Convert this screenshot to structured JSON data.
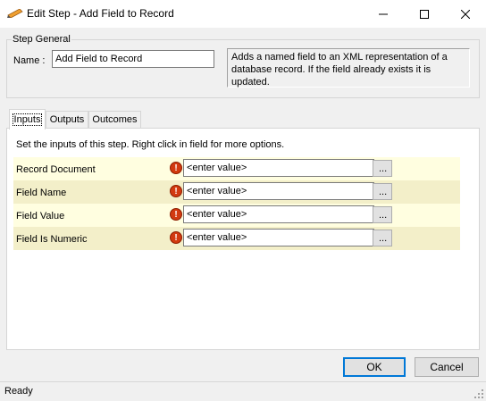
{
  "window": {
    "title": "Edit Step - Add Field to Record",
    "controls": {
      "minimize": "minimize-icon",
      "maximize": "maximize-icon",
      "close": "close-icon"
    }
  },
  "step_general": {
    "group_label": "Step General",
    "name_label": "Name :",
    "name_value": "Add Field to Record",
    "description": "Adds a named field to an XML representation of a database record. If the field already exists it is updated."
  },
  "tabs": [
    {
      "label": "Inputs",
      "active": true
    },
    {
      "label": "Outputs",
      "active": false
    },
    {
      "label": "Outcomes",
      "active": false
    }
  ],
  "inputs": {
    "instructions": "Set the inputs of this step.  Right click in field for more options.",
    "placeholder": "<enter value>",
    "browse_label": "...",
    "rows": [
      {
        "label": "Record Document",
        "value": "<enter value>"
      },
      {
        "label": "Field Name",
        "value": "<enter value>"
      },
      {
        "label": "Field Value",
        "value": "<enter value>"
      },
      {
        "label": "Field Is Numeric",
        "value": "<enter value>"
      }
    ]
  },
  "buttons": {
    "ok": "OK",
    "cancel": "Cancel"
  },
  "status": {
    "text": "Ready"
  },
  "colors": {
    "row_odd": "#fffee0",
    "row_even": "#f3efc9",
    "warning": "#d23a10",
    "ok_border": "#0078d7"
  }
}
